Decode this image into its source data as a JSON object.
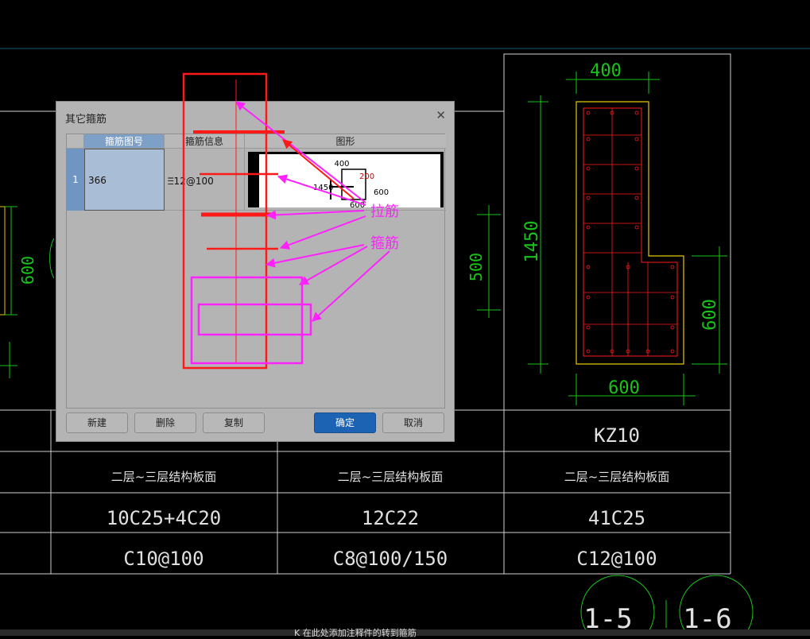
{
  "dialog": {
    "title": "其它箍筋",
    "headers": [
      "箍筋图号",
      "箍筋信息",
      "图形"
    ],
    "row": {
      "num": "1",
      "code": "366",
      "info": "Ⲷ12@100"
    },
    "shape_labels": {
      "top": "400",
      "red": "200",
      "left": "1450",
      "right": "600",
      "bottom": "600"
    },
    "buttons": {
      "new": "新建",
      "delete": "删除",
      "copy": "复制",
      "ok": "确定",
      "cancel": "取消"
    }
  },
  "annotations": {
    "tie": "拉筋",
    "stirrup": "箍筋"
  },
  "section": {
    "dims": {
      "top": "400",
      "left": "1450",
      "right_low": "600",
      "bottom": "600"
    }
  },
  "bg_dims": {
    "left_600": "600",
    "mid_500": "500"
  },
  "table": {
    "names": [
      "",
      "",
      "KZ10"
    ],
    "floors": [
      "二层~三层结构板面",
      "二层~三层结构板面",
      "二层~三层结构板面"
    ],
    "main_bars": [
      "10C25+4C20",
      "12C22",
      "41C25"
    ],
    "stirrups": [
      "C10@100",
      "C8@100/150",
      "C12@100"
    ]
  },
  "section_marks": [
    "1-5",
    "1-6"
  ],
  "taskbar_text": "K 在此处添加注释件的转到箍筋",
  "colors": {
    "cad_line": "#cfcfcf",
    "cad_green": "#19c319",
    "cad_yellow": "#e6c800",
    "cad_red": "#ff1a1a",
    "magenta": "#ff22ff",
    "accent_blue": "#1c63b3"
  }
}
